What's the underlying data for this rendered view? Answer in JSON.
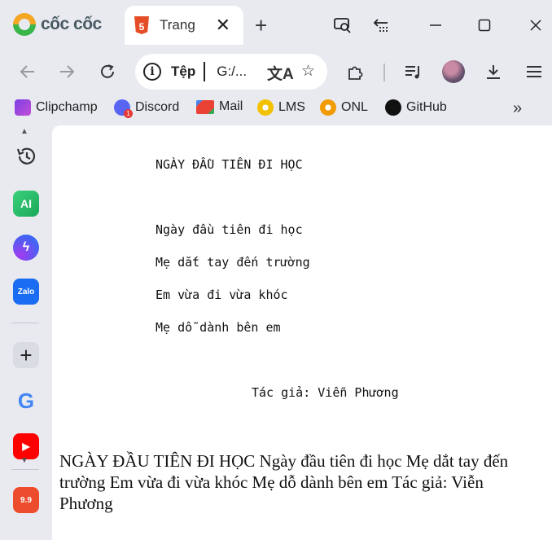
{
  "browser": {
    "brand": "cốc cốc",
    "tab": {
      "title": "Trang trước",
      "icon": "html5-icon"
    },
    "address": {
      "scheme": "Tệp",
      "url": "G:/..."
    },
    "bookmarks": [
      {
        "label": "Clipchamp",
        "icon": "clipchamp-icon",
        "color": "#7b3fe4"
      },
      {
        "label": "Discord",
        "icon": "discord-icon",
        "color": "#5865f2"
      },
      {
        "label": "Mail",
        "icon": "gmail-icon",
        "color": "#ea4335"
      },
      {
        "label": "LMS",
        "icon": "lms-icon",
        "color": "#f2c200"
      },
      {
        "label": "ONL",
        "icon": "onl-icon",
        "color": "#f29b00"
      },
      {
        "label": "GitHub",
        "icon": "github-icon",
        "color": "#111111"
      }
    ]
  },
  "sidebar": {
    "ai_label": "AI",
    "zalo_label": "Zalo",
    "shopee_label": "9.9"
  },
  "page": {
    "pre": {
      "title": "NGÀY ĐẦU TIÊN ĐI HỌC",
      "lines": [
        "Ngày đầu tiên đi học",
        "Mẹ dắt tay đến trường",
        "Em vừa đi vừa khóc",
        "Mẹ dỗ dành bên em"
      ],
      "author": "Tác giả: Viễn Phương"
    },
    "paragraph": "NGÀY ĐẦU TIÊN ĐI HỌC Ngày đầu tiên đi học Mẹ dắt tay đến trường Em vừa đi vừa khóc Mẹ dỗ dành bên em Tác giả: Viễn Phương"
  }
}
